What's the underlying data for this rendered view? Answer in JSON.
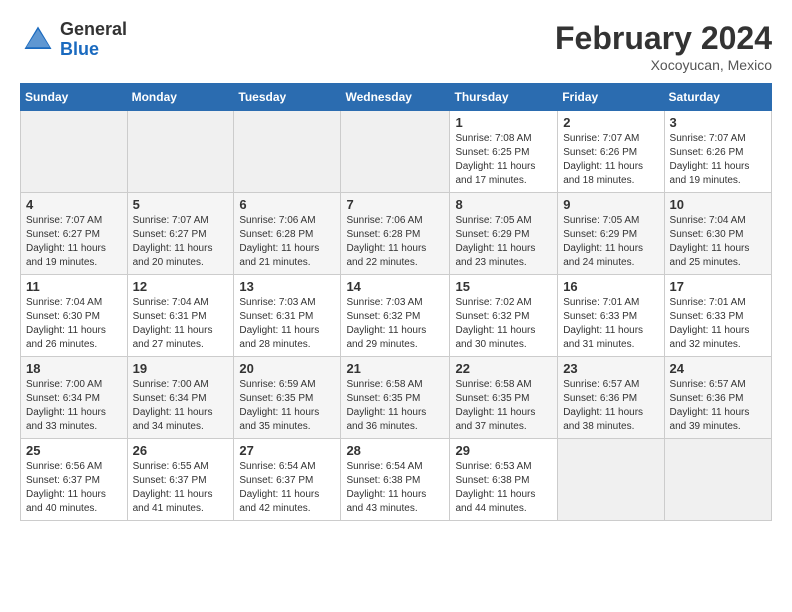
{
  "header": {
    "logo_general": "General",
    "logo_blue": "Blue",
    "month_title": "February 2024",
    "location": "Xocoyucan, Mexico"
  },
  "days_of_week": [
    "Sunday",
    "Monday",
    "Tuesday",
    "Wednesday",
    "Thursday",
    "Friday",
    "Saturday"
  ],
  "weeks": [
    [
      {
        "day": "",
        "info": ""
      },
      {
        "day": "",
        "info": ""
      },
      {
        "day": "",
        "info": ""
      },
      {
        "day": "",
        "info": ""
      },
      {
        "day": "1",
        "info": "Sunrise: 7:08 AM\nSunset: 6:25 PM\nDaylight: 11 hours\nand 17 minutes."
      },
      {
        "day": "2",
        "info": "Sunrise: 7:07 AM\nSunset: 6:26 PM\nDaylight: 11 hours\nand 18 minutes."
      },
      {
        "day": "3",
        "info": "Sunrise: 7:07 AM\nSunset: 6:26 PM\nDaylight: 11 hours\nand 19 minutes."
      }
    ],
    [
      {
        "day": "4",
        "info": "Sunrise: 7:07 AM\nSunset: 6:27 PM\nDaylight: 11 hours\nand 19 minutes."
      },
      {
        "day": "5",
        "info": "Sunrise: 7:07 AM\nSunset: 6:27 PM\nDaylight: 11 hours\nand 20 minutes."
      },
      {
        "day": "6",
        "info": "Sunrise: 7:06 AM\nSunset: 6:28 PM\nDaylight: 11 hours\nand 21 minutes."
      },
      {
        "day": "7",
        "info": "Sunrise: 7:06 AM\nSunset: 6:28 PM\nDaylight: 11 hours\nand 22 minutes."
      },
      {
        "day": "8",
        "info": "Sunrise: 7:05 AM\nSunset: 6:29 PM\nDaylight: 11 hours\nand 23 minutes."
      },
      {
        "day": "9",
        "info": "Sunrise: 7:05 AM\nSunset: 6:29 PM\nDaylight: 11 hours\nand 24 minutes."
      },
      {
        "day": "10",
        "info": "Sunrise: 7:04 AM\nSunset: 6:30 PM\nDaylight: 11 hours\nand 25 minutes."
      }
    ],
    [
      {
        "day": "11",
        "info": "Sunrise: 7:04 AM\nSunset: 6:30 PM\nDaylight: 11 hours\nand 26 minutes."
      },
      {
        "day": "12",
        "info": "Sunrise: 7:04 AM\nSunset: 6:31 PM\nDaylight: 11 hours\nand 27 minutes."
      },
      {
        "day": "13",
        "info": "Sunrise: 7:03 AM\nSunset: 6:31 PM\nDaylight: 11 hours\nand 28 minutes."
      },
      {
        "day": "14",
        "info": "Sunrise: 7:03 AM\nSunset: 6:32 PM\nDaylight: 11 hours\nand 29 minutes."
      },
      {
        "day": "15",
        "info": "Sunrise: 7:02 AM\nSunset: 6:32 PM\nDaylight: 11 hours\nand 30 minutes."
      },
      {
        "day": "16",
        "info": "Sunrise: 7:01 AM\nSunset: 6:33 PM\nDaylight: 11 hours\nand 31 minutes."
      },
      {
        "day": "17",
        "info": "Sunrise: 7:01 AM\nSunset: 6:33 PM\nDaylight: 11 hours\nand 32 minutes."
      }
    ],
    [
      {
        "day": "18",
        "info": "Sunrise: 7:00 AM\nSunset: 6:34 PM\nDaylight: 11 hours\nand 33 minutes."
      },
      {
        "day": "19",
        "info": "Sunrise: 7:00 AM\nSunset: 6:34 PM\nDaylight: 11 hours\nand 34 minutes."
      },
      {
        "day": "20",
        "info": "Sunrise: 6:59 AM\nSunset: 6:35 PM\nDaylight: 11 hours\nand 35 minutes."
      },
      {
        "day": "21",
        "info": "Sunrise: 6:58 AM\nSunset: 6:35 PM\nDaylight: 11 hours\nand 36 minutes."
      },
      {
        "day": "22",
        "info": "Sunrise: 6:58 AM\nSunset: 6:35 PM\nDaylight: 11 hours\nand 37 minutes."
      },
      {
        "day": "23",
        "info": "Sunrise: 6:57 AM\nSunset: 6:36 PM\nDaylight: 11 hours\nand 38 minutes."
      },
      {
        "day": "24",
        "info": "Sunrise: 6:57 AM\nSunset: 6:36 PM\nDaylight: 11 hours\nand 39 minutes."
      }
    ],
    [
      {
        "day": "25",
        "info": "Sunrise: 6:56 AM\nSunset: 6:37 PM\nDaylight: 11 hours\nand 40 minutes."
      },
      {
        "day": "26",
        "info": "Sunrise: 6:55 AM\nSunset: 6:37 PM\nDaylight: 11 hours\nand 41 minutes."
      },
      {
        "day": "27",
        "info": "Sunrise: 6:54 AM\nSunset: 6:37 PM\nDaylight: 11 hours\nand 42 minutes."
      },
      {
        "day": "28",
        "info": "Sunrise: 6:54 AM\nSunset: 6:38 PM\nDaylight: 11 hours\nand 43 minutes."
      },
      {
        "day": "29",
        "info": "Sunrise: 6:53 AM\nSunset: 6:38 PM\nDaylight: 11 hours\nand 44 minutes."
      },
      {
        "day": "",
        "info": ""
      },
      {
        "day": "",
        "info": ""
      }
    ]
  ]
}
